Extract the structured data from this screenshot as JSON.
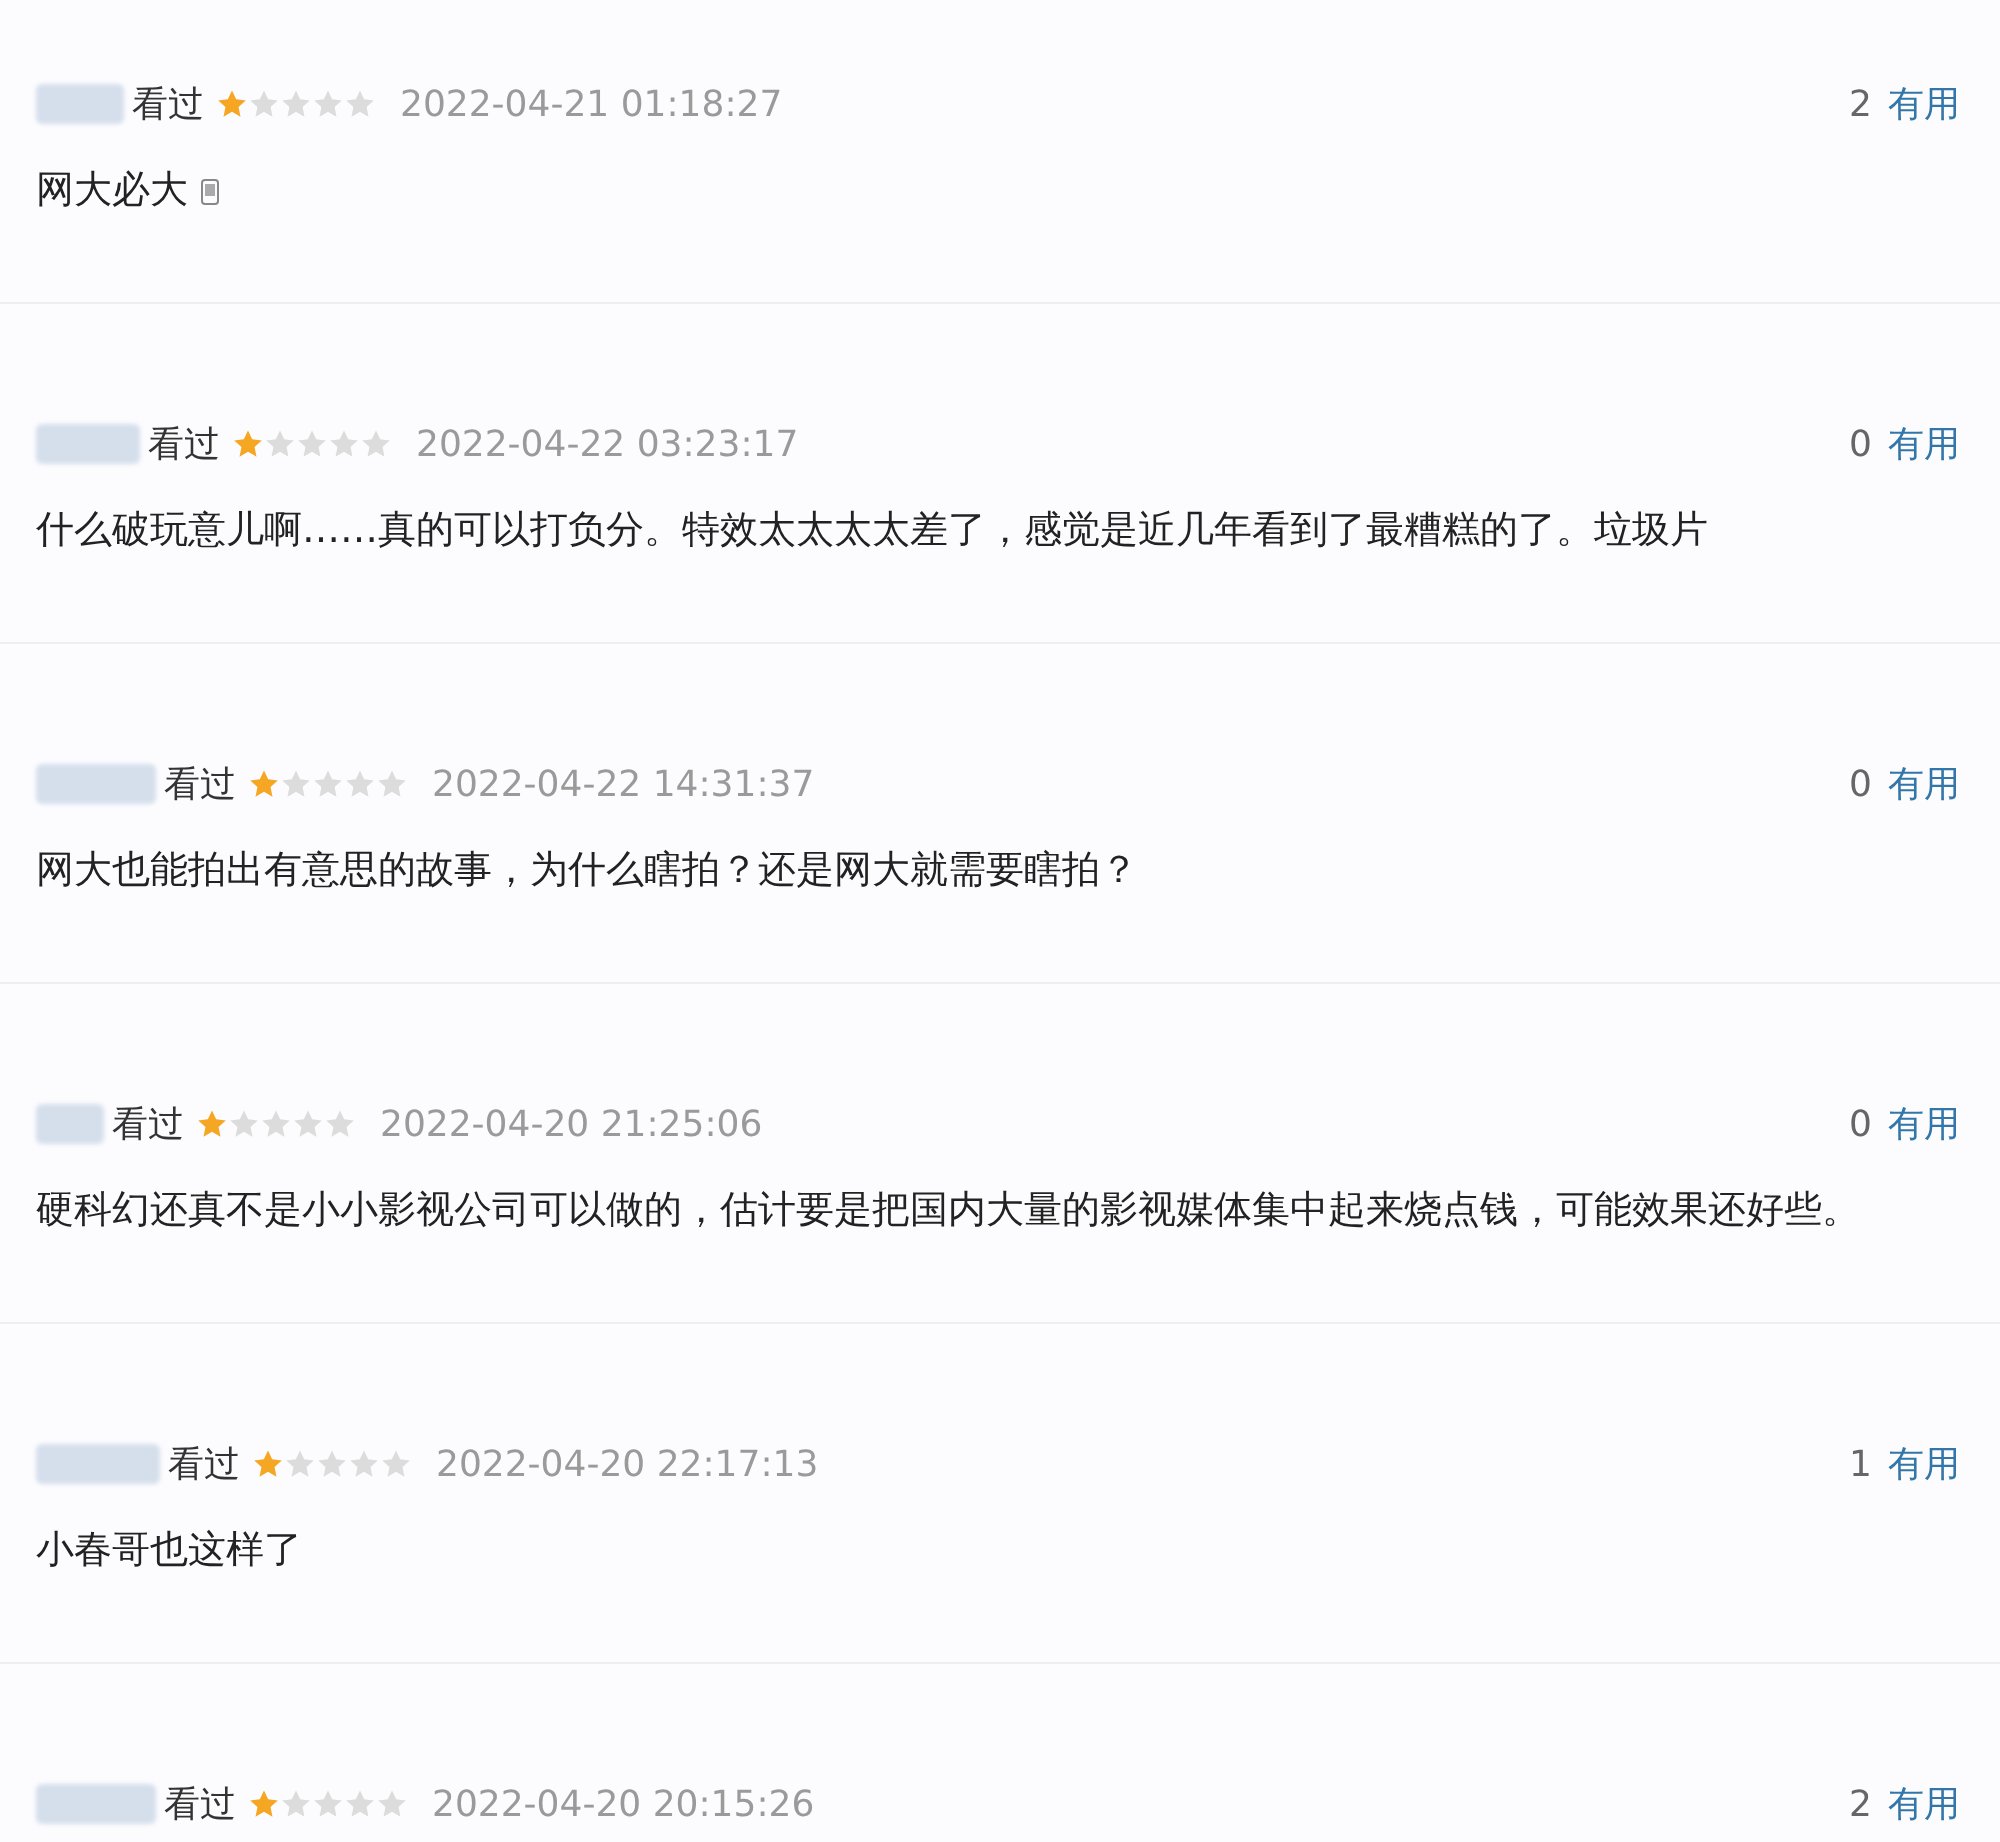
{
  "reviews": [
    {
      "status": "看过",
      "stars": 1,
      "time": "2022-04-21 01:18:27",
      "useful_count": "2",
      "useful_label": "有用",
      "text": "网大必大",
      "has_phone_icon": true
    },
    {
      "status": "看过",
      "stars": 1,
      "time": "2022-04-22 03:23:17",
      "useful_count": "0",
      "useful_label": "有用",
      "text": "什么破玩意儿啊……真的可以打负分。特效太太太太差了，感觉是近几年看到了最糟糕的了。垃圾片",
      "has_phone_icon": false
    },
    {
      "status": "看过",
      "stars": 1,
      "time": "2022-04-22 14:31:37",
      "useful_count": "0",
      "useful_label": "有用",
      "text": "网大也能拍出有意思的故事，为什么瞎拍？还是网大就需要瞎拍？",
      "has_phone_icon": false
    },
    {
      "status": "看过",
      "stars": 1,
      "time": "2022-04-20 21:25:06",
      "useful_count": "0",
      "useful_label": "有用",
      "text": "硬科幻还真不是小小影视公司可以做的，估计要是把国内大量的影视媒体集中起来烧点钱，可能效果还好些。",
      "has_phone_icon": false
    },
    {
      "status": "看过",
      "stars": 1,
      "time": "2022-04-20 22:17:13",
      "useful_count": "1",
      "useful_label": "有用",
      "text": "小春哥也这样了",
      "has_phone_icon": false
    },
    {
      "status": "看过",
      "stars": 1,
      "time": "2022-04-20 20:15:26",
      "useful_count": "2",
      "useful_label": "有用",
      "has_phone_icon": false
    }
  ]
}
